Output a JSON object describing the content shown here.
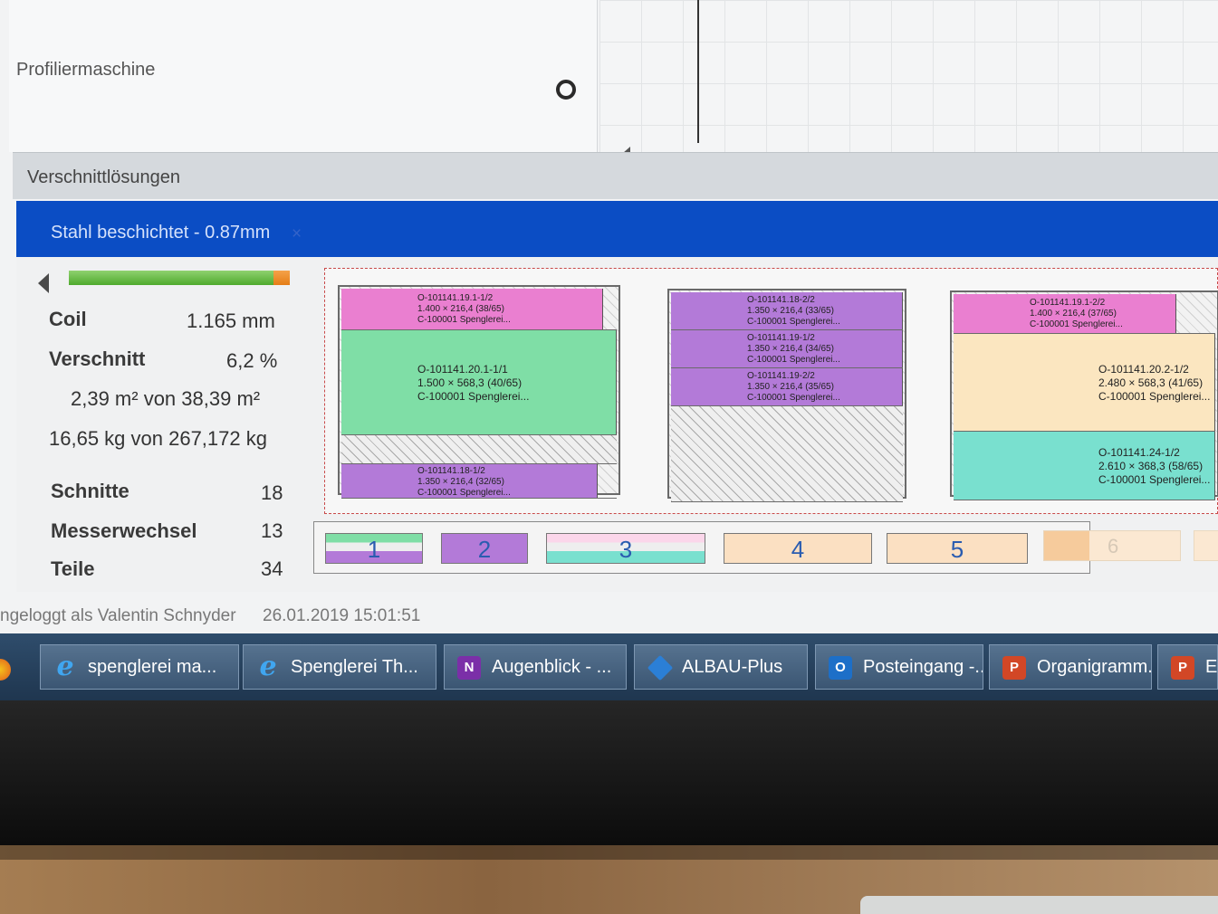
{
  "profil": {
    "machine_label": "Profiliermaschine"
  },
  "panel": {
    "title": "Verschnittlösungen"
  },
  "material_tab": {
    "label": "Stahl beschichtet - 0.87mm",
    "close": "×"
  },
  "progress": {
    "fraction": 1.0
  },
  "stats": {
    "coil_label": "Coil",
    "coil_value": "1.165 mm",
    "waste_label": "Verschnitt",
    "waste_value": "6,2 %",
    "area": "2,39 m² von 38,39 m²",
    "weight": "16,65 kg von 267,172 kg",
    "cuts_label": "Schnitte",
    "cuts_value": "18",
    "knife_label": "Messerwechsel",
    "knife_value": "13",
    "parts_label": "Teile",
    "parts_value": "34"
  },
  "solutions": [
    {
      "strips": [
        {
          "color": "#ea7fd0",
          "fill": 0.95,
          "lines": [
            "O-101141.19.1-1/2",
            "1.400 × 216,4 (38/65)",
            "C-100001 Spenglerei..."
          ]
        },
        {
          "color": "#7fdea6",
          "fill": 1.0,
          "lines": [
            "O-101141.20.1-1/1",
            "1.500 × 568,3 (40/65)",
            "C-100001 Spenglerei..."
          ]
        },
        {
          "color": "waste",
          "fill": 0,
          "lines": []
        },
        {
          "color": "#b37ad8",
          "fill": 0.93,
          "lines": [
            "O-101141.18-1/2",
            "1.350 × 216,4 (32/65)",
            "C-100001 Spenglerei..."
          ]
        }
      ]
    },
    {
      "strips": [
        {
          "color": "#b37ad8",
          "fill": 1.0,
          "lines": [
            "O-101141.18-2/2",
            "1.350 × 216,4 (33/65)",
            "C-100001 Spenglerei..."
          ]
        },
        {
          "color": "#b37ad8",
          "fill": 1.0,
          "lines": [
            "O-101141.19-1/2",
            "1.350 × 216,4 (34/65)",
            "C-100001 Spenglerei..."
          ]
        },
        {
          "color": "#b37ad8",
          "fill": 1.0,
          "lines": [
            "O-101141.19-2/2",
            "1.350 × 216,4 (35/65)",
            "C-100001 Spenglerei..."
          ]
        },
        {
          "color": "waste",
          "fill": 0,
          "lines": []
        }
      ]
    },
    {
      "strips": [
        {
          "color": "#ea7fd0",
          "fill": 0.85,
          "lines": [
            "O-101141.19.1-2/2",
            "1.400 × 216,4 (37/65)",
            "C-100001 Spenglerei..."
          ]
        },
        {
          "color": "#fbe6c0",
          "fill": 1.0,
          "lines": [
            "O-101141.20.2-1/2",
            "2.480 × 568,3 (41/65)",
            "C-100001 Spenglerei..."
          ]
        },
        {
          "color": "#79e0cf",
          "fill": 1.0,
          "lines": [
            "O-101141.24-1/2",
            "2.610 × 368,3 (58/65)",
            "C-100001 Spenglerei..."
          ]
        }
      ]
    }
  ],
  "thumbs": [
    "1",
    "2",
    "3",
    "4",
    "5",
    "6"
  ],
  "status": {
    "user": "ngeloggt als Valentin Schnyder",
    "datetime": "26.01.2019 15:01:51"
  },
  "taskbar": [
    {
      "label": "spenglerei ma...",
      "icon": "internet-explorer-icon"
    },
    {
      "label": "Spenglerei Th...",
      "icon": "internet-explorer-icon"
    },
    {
      "label": "Augenblick - ...",
      "icon": "onenote-icon"
    },
    {
      "label": "ALBAU-Plus",
      "icon": "albau-icon"
    },
    {
      "label": "Posteingang -...",
      "icon": "outlook-icon"
    },
    {
      "label": "Organigramm...",
      "icon": "powerpoint-icon"
    },
    {
      "label": "Ent",
      "icon": "powerpoint-icon"
    }
  ],
  "colors": {
    "tab_blue": "#0b4dc4",
    "taskbar": "#2f4d6c"
  }
}
